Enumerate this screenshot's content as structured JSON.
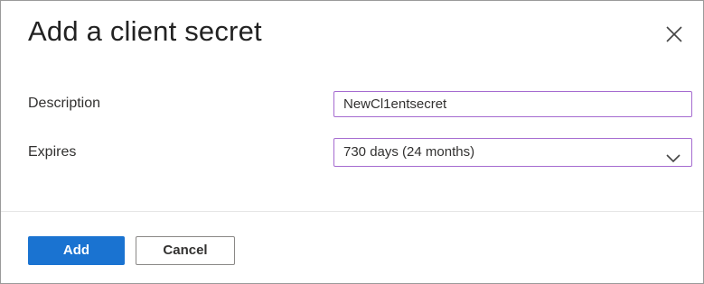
{
  "dialog": {
    "title": "Add a client secret",
    "close_icon": "close-icon"
  },
  "form": {
    "description_label": "Description",
    "description_value": "NewCl1entsecret",
    "expires_label": "Expires",
    "expires_value": "730 days (24 months)",
    "expires_icon": "chevron-down-icon"
  },
  "footer": {
    "add_label": "Add",
    "cancel_label": "Cancel"
  },
  "colors": {
    "primary": "#1a73d1",
    "field_border": "#a56bd0"
  }
}
